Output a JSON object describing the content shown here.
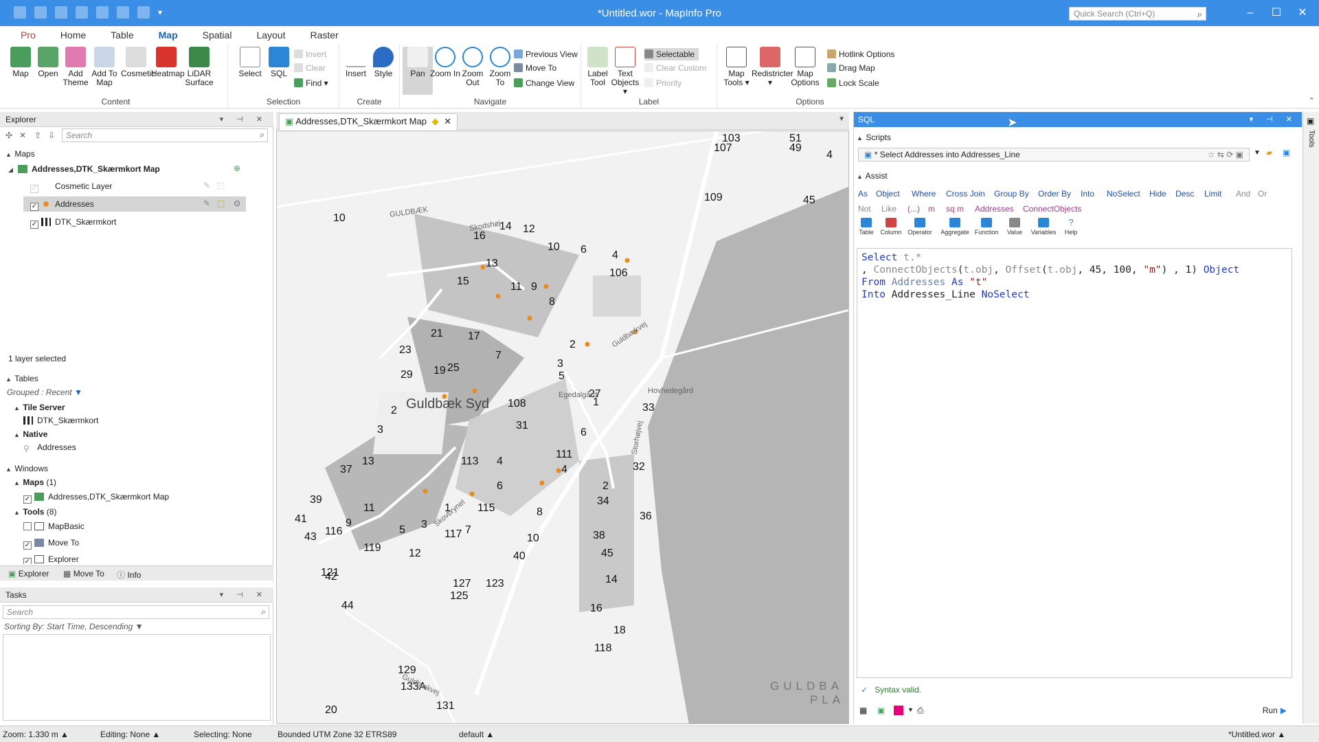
{
  "window": {
    "title": "*Untitled.wor - MapInfo Pro",
    "quick_search_placeholder": "Quick Search (Ctrl+Q)"
  },
  "ribbon": {
    "tabs": [
      "Pro",
      "Home",
      "Table",
      "Map",
      "Spatial",
      "Layout",
      "Raster"
    ],
    "active_tab": "Map",
    "groups": {
      "content": {
        "label": "Content",
        "buttons": [
          "Map",
          "Open",
          "Add Theme",
          "Add To Map",
          "Cosmetic",
          "Heatmap",
          "LiDAR Surface"
        ]
      },
      "selection": {
        "label": "Selection",
        "buttons": [
          "Select",
          "SQL"
        ],
        "small": [
          "Invert",
          "Clear",
          "Find"
        ]
      },
      "create": {
        "label": "Create",
        "buttons": [
          "Insert",
          "Style"
        ]
      },
      "navigate": {
        "label": "Navigate",
        "buttons": [
          "Pan",
          "Zoom In",
          "Zoom Out",
          "Zoom To"
        ],
        "small": [
          "Previous View",
          "Move To",
          "Change View"
        ]
      },
      "label": {
        "label": "Label",
        "buttons": [
          "Label Tool",
          "Text Objects"
        ],
        "small": [
          "Selectable",
          "Clear Custom",
          "Priority"
        ]
      },
      "options": {
        "label": "Options",
        "buttons": [
          "Map Tools",
          "Redistricter",
          "Map Options"
        ],
        "small": [
          "Hotlink Options",
          "Drag Map",
          "Lock Scale"
        ]
      }
    }
  },
  "explorer": {
    "title": "Explorer",
    "search_placeholder": "Search",
    "maps_heading": "Maps",
    "map_name": "Addresses,DTK_Skærmkort Map",
    "layers": [
      "Cosmetic Layer",
      "Addresses",
      "DTK_Skærmkort"
    ],
    "layer_status": "1 layer selected",
    "tables_heading": "Tables",
    "grouped": "Grouped : Recent",
    "tile_server": "Tile Server",
    "tile_table": "DTK_Skærmkort",
    "native": "Native",
    "native_table": "Addresses",
    "windows_heading": "Windows",
    "maps_count": "Maps",
    "maps_count_num": "(1)",
    "window_map": "Addresses,DTK_Skærmkort Map",
    "tools_heading": "Tools",
    "tools_count": "(8)",
    "tools": [
      "MapBasic",
      "Move To",
      "Explorer"
    ],
    "bottom_tabs": [
      "Explorer",
      "Move To",
      "Info"
    ]
  },
  "tasks": {
    "title": "Tasks",
    "search_placeholder": "Search",
    "sorting": "Sorting By: Start Time, Descending"
  },
  "map_window": {
    "tab_title": "Addresses,DTK_Skærmkort Map",
    "place_name": "Guldbæk Syd",
    "roads": [
      "GULDBÆK",
      "Skodshøj",
      "Guldbækvej",
      "Egedalgård",
      "Hovhedegård",
      "Storhøjvej",
      "Skovbrynet",
      "Guldbækvej"
    ],
    "faint_label_1": "GULDBA",
    "faint_label_2": "PLA",
    "address_labels": [
      "103",
      "51",
      "107",
      "49",
      "4",
      "109",
      "45",
      "10",
      "16",
      "14",
      "12",
      "10",
      "6",
      "4",
      "106",
      "13",
      "11",
      "15",
      "8",
      "9",
      "21",
      "17",
      "7",
      "2",
      "23",
      "19",
      "3",
      "29",
      "25",
      "5",
      "1",
      "108",
      "27",
      "2",
      "33",
      "3",
      "31",
      "6",
      "4",
      "111",
      "32",
      "37",
      "13",
      "113",
      "4",
      "2",
      "6",
      "34",
      "39",
      "11",
      "1",
      "115",
      "8",
      "36",
      "41",
      "9",
      "3",
      "7",
      "5",
      "117",
      "10",
      "38",
      "43",
      "116",
      "119",
      "12",
      "40",
      "45",
      "121",
      "42",
      "127",
      "123",
      "14",
      "125",
      "44",
      "16",
      "18",
      "118",
      "20",
      "129",
      "133A",
      "131"
    ]
  },
  "sql": {
    "title": "SQL",
    "scripts_heading": "Scripts",
    "script_name": "* Select Addresses into Addresses_Line",
    "assist_heading": "Assist",
    "assist_row1": [
      "As",
      "Object",
      "Where",
      "Cross Join",
      "Group By",
      "Order By",
      "Into",
      "NoSelect",
      "Hide",
      "Desc",
      "Limit",
      "And",
      "Or"
    ],
    "assist_row2": [
      "Not",
      "Like",
      "(...)",
      "m",
      "sq m",
      "Addresses",
      "ConnectObjects"
    ],
    "assist_buttons": [
      "Table",
      "Column",
      "Operator",
      "Aggregate",
      "Function",
      "Value",
      "Variables",
      "Help"
    ],
    "code": {
      "l1a": "Select",
      "l1b": "t.*",
      "l2a": ",",
      "l2b": "ConnectObjects",
      "l2c": "(",
      "l2d": "t.obj",
      "l2e": ",",
      "l2f": "Offset",
      "l2g": "(",
      "l2h": "t.obj",
      "l2i": ", 45, 100,",
      "l2j": "\"m\"",
      "l2k": ") , 1)",
      "l2l": "Object",
      "l3a": "From",
      "l3b": "Addresses",
      "l3c": "As",
      "l3d": "\"t\"",
      "l4a": "Into",
      "l4b": "Addresses_Line",
      "l4c": "NoSelect"
    },
    "status": "Syntax valid.",
    "run_label": "Run"
  },
  "statusbar": {
    "zoom": "Zoom: 1.330 m",
    "editing": "Editing: None",
    "selecting": "Selecting: None",
    "projection": "Bounded UTM Zone 32 ETRS89",
    "style": "default",
    "workspace": "*Untitled.wor"
  }
}
